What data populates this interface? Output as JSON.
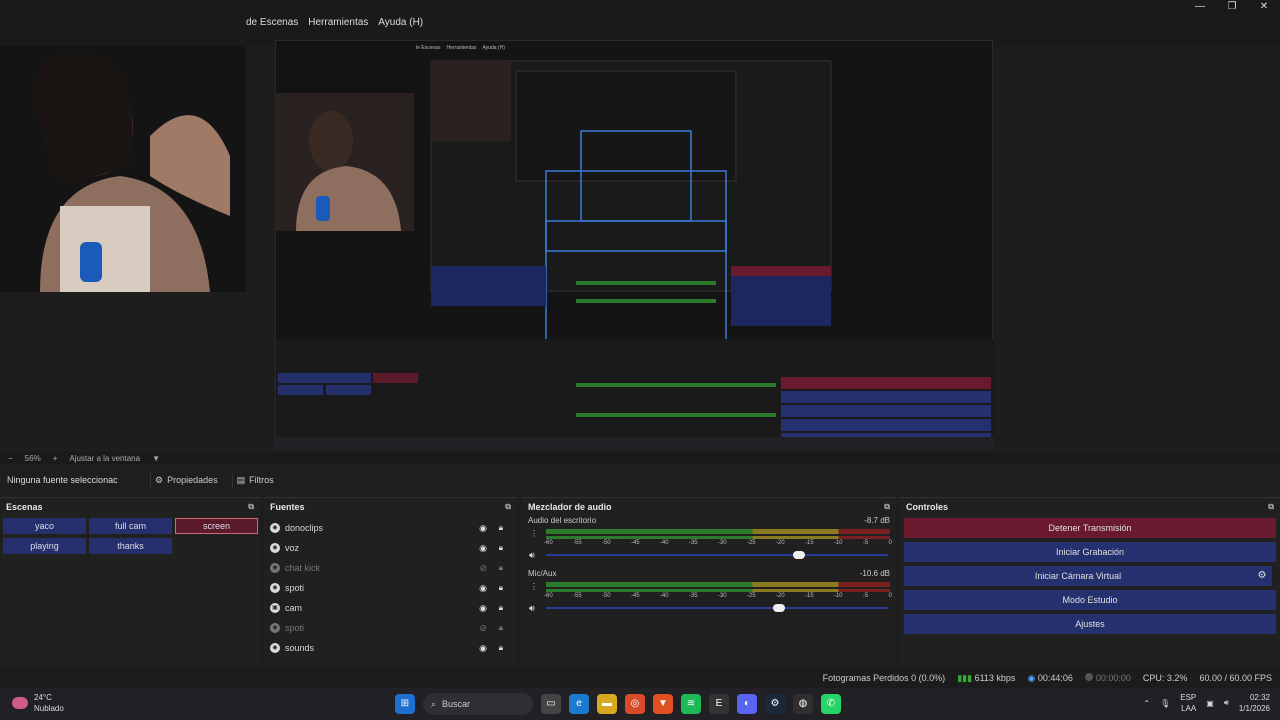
{
  "menu": {
    "items": [
      "de Escenas",
      "Herramientas",
      "Ayuda (H)"
    ],
    "window_controls": [
      "—",
      "❐",
      "✕"
    ]
  },
  "preview": {
    "nested_menu": [
      "le Escenas",
      "Herramientas",
      "Ayuda (H)"
    ]
  },
  "zoombar": {
    "minus": "−",
    "zoom": "56%",
    "plus": "+",
    "fit_label": "Ajustar a la ventana",
    "caret": "▼"
  },
  "propbar": {
    "no_selection": "Ninguna fuente seleccionac",
    "properties_label": "Propiedades",
    "filters_label": "Filtros"
  },
  "scenes": {
    "title": "Escenas",
    "items": [
      {
        "label": "yaco",
        "active": false
      },
      {
        "label": "full cam",
        "active": false
      },
      {
        "label": "screen",
        "active": true
      },
      {
        "label": "playing",
        "active": false
      },
      {
        "label": "thanks",
        "active": false
      }
    ]
  },
  "sources": {
    "title": "Fuentes",
    "items": [
      {
        "label": "donoclips",
        "visible": true
      },
      {
        "label": "voz",
        "visible": true
      },
      {
        "label": "chat kick",
        "visible": false
      },
      {
        "label": "spoti",
        "visible": true
      },
      {
        "label": "cam",
        "visible": true
      },
      {
        "label": "spoti",
        "visible": false
      },
      {
        "label": "sounds",
        "visible": true
      }
    ]
  },
  "mixer": {
    "title": "Mezclador de audio",
    "channels": [
      {
        "name": "Audio del escritorio",
        "db": "-8.7 dB",
        "volume": 0.74
      },
      {
        "name": "Mic/Aux",
        "db": "-10.6 dB",
        "volume": 0.68
      }
    ],
    "ticks": [
      "-60",
      "-55",
      "-50",
      "-45",
      "-40",
      "-35",
      "-30",
      "-25",
      "-20",
      "-15",
      "-10",
      "-5",
      "0"
    ]
  },
  "controls": {
    "title": "Controles",
    "stop_stream": "Detener Transmisión",
    "start_recording": "Iniciar Grabación",
    "start_vcam": "Iniciar Cámara Virtual",
    "studio_mode": "Modo Estudio",
    "settings": "Ajustes"
  },
  "status": {
    "dropped_frames": "Fotogramas Perdidos 0 (0.0%)",
    "bitrate": "6113 kbps",
    "stream_time": "00:44:06",
    "rec_time": "00:00:00",
    "cpu": "CPU: 3.2%",
    "fps": "60.00 / 60.00 FPS"
  },
  "taskbar": {
    "temp": "24°C",
    "weather": "Nublado",
    "search": "Buscar",
    "lang": "ESP",
    "lang2": "LAA",
    "time": "02:32",
    "date": "1/1/2026"
  },
  "colors": {
    "scene_button": "#252f6b",
    "active_scene": "#5a1a2a",
    "stop_button": "#6a1a2e",
    "control_button": "#25306e"
  }
}
